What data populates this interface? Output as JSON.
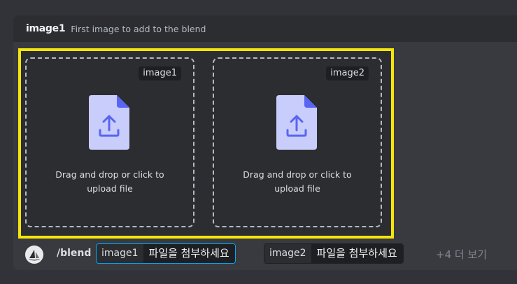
{
  "option": {
    "name": "image1",
    "description": "First image to add to the blend"
  },
  "dropzones": [
    {
      "tag": "image1",
      "text_line1": "Drag and drop or click to",
      "text_line2": "upload file",
      "icon": "file-upload-icon"
    },
    {
      "tag": "image2",
      "text_line1": "Drag and drop or click to",
      "text_line2": "upload file",
      "icon": "file-upload-icon"
    }
  ],
  "command": {
    "name": "/blend",
    "avatar_icon": "bot-avatar-icon",
    "params": [
      {
        "key": "image1",
        "value": "파일을 첨부하세요",
        "active": true
      },
      {
        "key": "image2",
        "value": "파일을 첨부하세요",
        "active": false
      }
    ],
    "more_label": "+4 더 보기"
  },
  "colors": {
    "background": "#313338",
    "panel": "#383a40",
    "highlight_border": "#f5e50a",
    "active_param_border": "#00a8fc",
    "file_icon_body": "#c9cdfb",
    "file_icon_accent": "#5865f2"
  }
}
